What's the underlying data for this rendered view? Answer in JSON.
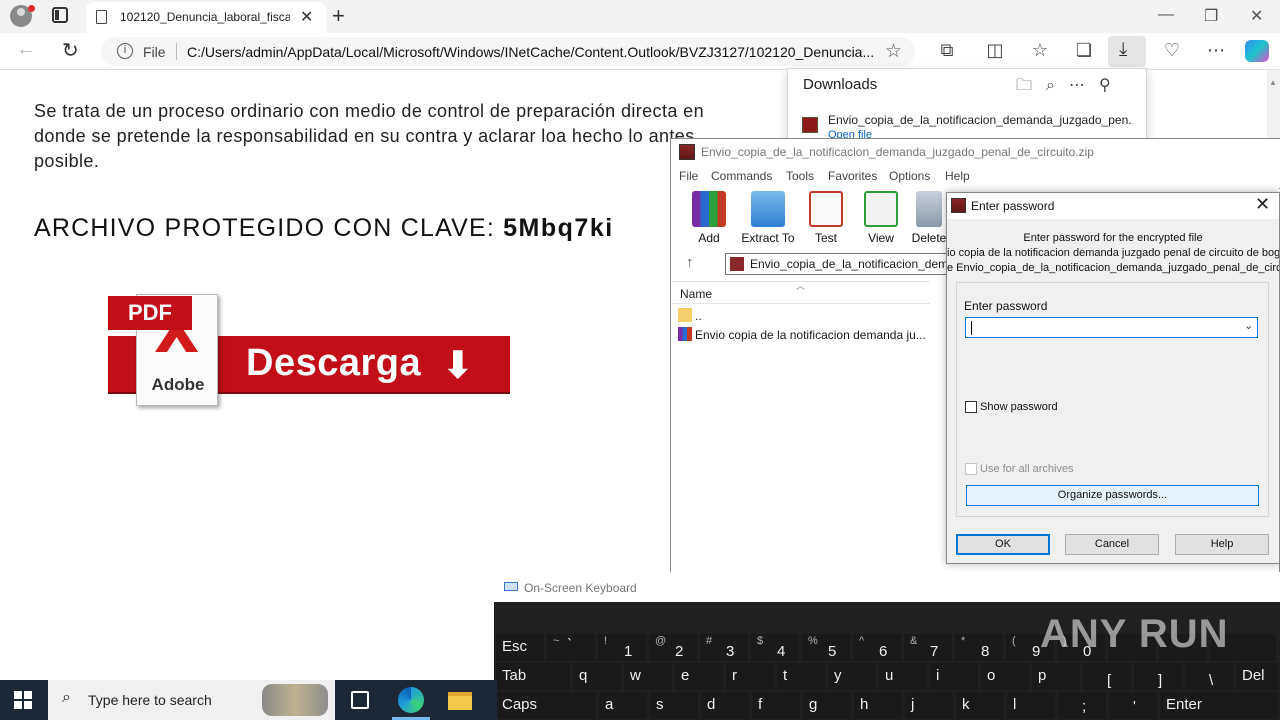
{
  "browser": {
    "tab_title": "102120_Denuncia_laboral_fiscal_",
    "file_label": "File",
    "url": "C:/Users/admin/AppData/Local/Microsoft/Windows/INetCache/Content.Outlook/BVZJ3127/102120_Denuncia..."
  },
  "page": {
    "paragraph": "Se trata de un proceso ordinario con medio de control de preparación directa en donde se pretende la responsabilidad en su contra y aclarar loa hecho lo antes posible.",
    "key_label": "ARCHIVO PROTEGIDO CON CLAVE: ",
    "key_value": "5Mbq7ki",
    "banner": {
      "pdf_tag": "PDF",
      "adobe": "Adobe",
      "text": "Descarga",
      "arrow": "⬇"
    }
  },
  "downloads": {
    "title": "Downloads",
    "item_name": "Envio_copia_de_la_notificacion_demanda_juzgado_pen...",
    "item_link": "Open file"
  },
  "winrar": {
    "title": "Envio_copia_de_la_notificacion_demanda_juzgado_penal_de_circuito.zip",
    "menu": [
      "File",
      "Commands",
      "Tools",
      "Favorites",
      "Options",
      "Help"
    ],
    "tools": [
      "Add",
      "Extract To",
      "Test",
      "View",
      "Delete"
    ],
    "path": "Envio_copia_de_la_notificacion_dema",
    "column_name": "Name",
    "rows": [
      "..",
      "Envio copia de la notificacion demanda ju..."
    ]
  },
  "password_dialog": {
    "title": "Enter password",
    "line1": "Enter password for the encrypted file",
    "line2": "io copia de la notificacion demanda juzgado penal de circuito de bogo",
    "line3": "e Envio_copia_de_la_notificacion_demanda_juzgado_penal_de_circ",
    "field_label": "Enter password",
    "field_value": "",
    "show_password": "Show password",
    "use_for_all": "Use for all archives",
    "organize": "Organize passwords...",
    "ok": "OK",
    "cancel": "Cancel",
    "help": "Help"
  },
  "osk": {
    "title": "On-Screen Keyboard",
    "row1": [
      {
        "main": "Esc",
        "top": ""
      },
      {
        "main": "`",
        "top": "~"
      },
      {
        "main": "1",
        "top": "!"
      },
      {
        "main": "2",
        "top": "@"
      },
      {
        "main": "3",
        "top": "#"
      },
      {
        "main": "4",
        "top": "$"
      },
      {
        "main": "5",
        "top": "%"
      },
      {
        "main": "6",
        "top": "^"
      },
      {
        "main": "7",
        "top": "&"
      },
      {
        "main": "8",
        "top": "*"
      },
      {
        "main": "9",
        "top": "("
      },
      {
        "main": "0",
        "top": ")"
      }
    ],
    "row2": [
      "Tab",
      "q",
      "w",
      "e",
      "r",
      "t",
      "y",
      "u",
      "i",
      "o",
      "p",
      "[",
      "]",
      "\\",
      "Del"
    ],
    "row3": [
      "Caps",
      "a",
      "s",
      "d",
      "f",
      "g",
      "h",
      "j",
      "k",
      "l",
      ";",
      "'",
      "Enter"
    ],
    "watermark": "ANY RUN"
  },
  "taskbar": {
    "search_placeholder": "Type here to search"
  },
  "colors": {
    "banner_red": "#c20e16",
    "dialog_accent": "#0078d7",
    "taskbar_bg": "#1d2836"
  }
}
